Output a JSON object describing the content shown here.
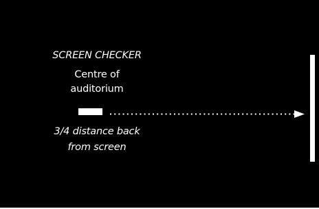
{
  "title": "SCREEN CHECKER",
  "label_top_line1": "Centre of",
  "label_top_line2": "auditorium",
  "label_bottom_line1": "3/4 distance back",
  "label_bottom_line2": "from screen",
  "colors": {
    "background": "#000000",
    "foreground": "#ffffff"
  }
}
